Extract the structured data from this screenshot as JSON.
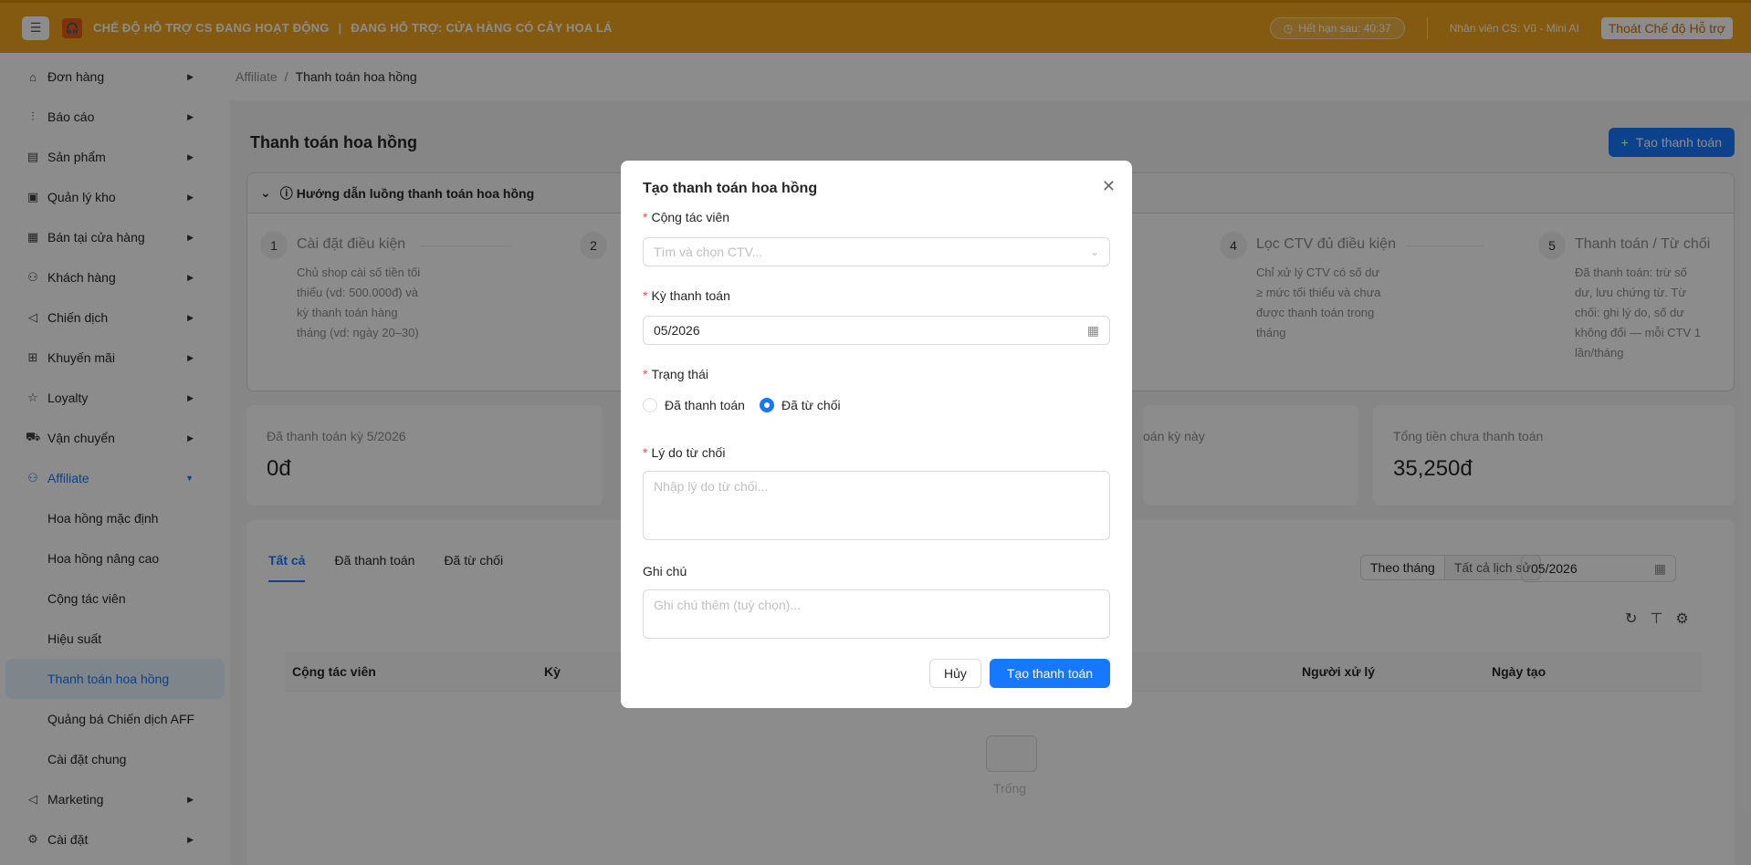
{
  "banner": {
    "mode_text": "CHẾ ĐỘ HỖ TRỢ CS ĐANG HOẠT ĐỘNG",
    "support_text": "ĐANG HỖ TRỢ: CỬA HÀNG CÓ CÂY HOA LÁ",
    "timer": "Hết hạn sau: 40:37",
    "staff": "Nhân viên CS: Vũ - Mini AI",
    "exit_label": "Thoát Chế độ Hỗ trợ"
  },
  "sidebar": {
    "items": [
      {
        "label": "Đơn hàng",
        "icon": "bag-icon"
      },
      {
        "label": "Báo cáo",
        "icon": "chart-icon"
      },
      {
        "label": "Sản phẩm",
        "icon": "product-icon"
      },
      {
        "label": "Quản lý kho",
        "icon": "warehouse-icon"
      },
      {
        "label": "Bán tại cửa hàng",
        "icon": "store-icon"
      },
      {
        "label": "Khách hàng",
        "icon": "users-icon"
      },
      {
        "label": "Chiến dịch",
        "icon": "sound-icon"
      },
      {
        "label": "Khuyến mãi",
        "icon": "gift-icon"
      },
      {
        "label": "Loyalty",
        "icon": "star-icon"
      },
      {
        "label": "Vận chuyển",
        "icon": "truck-icon"
      }
    ],
    "affiliate": {
      "label": "Affiliate",
      "icon": "affiliate-icon"
    },
    "sub_items": [
      "Hoa hồng mặc định",
      "Hoa hồng nâng cao",
      "Cộng tác viên",
      "Hiệu suất",
      "Thanh toán hoa hồng",
      "Quảng bá Chiến dịch AFF",
      "Cài đặt chung"
    ],
    "bottom_items": [
      {
        "label": "Marketing",
        "icon": "marketing-icon"
      },
      {
        "label": "Cài đặt",
        "icon": "settings-icon"
      }
    ]
  },
  "breadcrumb": {
    "parent": "Affiliate",
    "current": "Thanh toán hoa hồng"
  },
  "page": {
    "title": "Thanh toán hoa hồng",
    "create_label": "Tạo thanh toán"
  },
  "guide": {
    "title": "Hướng dẫn luồng thanh toán hoa hồng",
    "steps": [
      {
        "num": "1",
        "title": "Cài đặt điều kiện",
        "desc": "Chủ shop cài số tiền tối thiểu (vd: 500.000đ) và kỳ thanh toán hàng tháng (vd: ngày 20–30)"
      },
      {
        "num": "2",
        "title": "",
        "desc": ""
      },
      {
        "num": "4",
        "title": "Lọc CTV đủ điều kiện",
        "desc": "Chỉ xử lý CTV có số dư ≥ mức tối thiểu và chưa được thanh toán trong tháng"
      },
      {
        "num": "5",
        "title": "Thanh toán / Từ chối",
        "desc": "Đã thanh toán: trừ số dư, lưu chứng từ. Từ chối: ghi lý do, số dư không đổi — mỗi CTV 1 lần/tháng"
      }
    ]
  },
  "stats": [
    {
      "label": "Đã thanh toán kỳ 5/2026",
      "value": "0đ"
    },
    {
      "label": "oán kỳ này",
      "value": ""
    },
    {
      "label": "Tổng tiền chưa thanh toán",
      "value": "35,250đ"
    }
  ],
  "tabs": [
    "Tất cả",
    "Đã thanh toán",
    "Đã từ chối"
  ],
  "filter": {
    "by_month": "Theo tháng",
    "all_history": "Tất cả lịch sử",
    "period": "05/2026"
  },
  "table": {
    "columns": [
      "Cộng tác viên",
      "Kỳ",
      "Người xử lý",
      "Ngày tạo"
    ],
    "empty_text": "Trống"
  },
  "modal": {
    "title": "Tạo thanh toán hoa hồng",
    "ctv_label": "Cộng tác viên",
    "ctv_placeholder": "Tìm và chọn CTV...",
    "period_label": "Kỳ thanh toán",
    "period_value": "05/2026",
    "status_label": "Trạng thái",
    "status_paid": "Đã thanh toán",
    "status_rejected": "Đã từ chối",
    "reason_label": "Lý do từ chối",
    "reason_placeholder": "Nhập lý do từ chối...",
    "note_label": "Ghi chú",
    "note_placeholder": "Ghi chú thêm (tuỳ chọn)...",
    "cancel_label": "Hủy",
    "submit_label": "Tạo thanh toán"
  },
  "colors": {
    "banner": "#efa51d",
    "primary": "#1677ff",
    "required": "#ff4d4f"
  }
}
